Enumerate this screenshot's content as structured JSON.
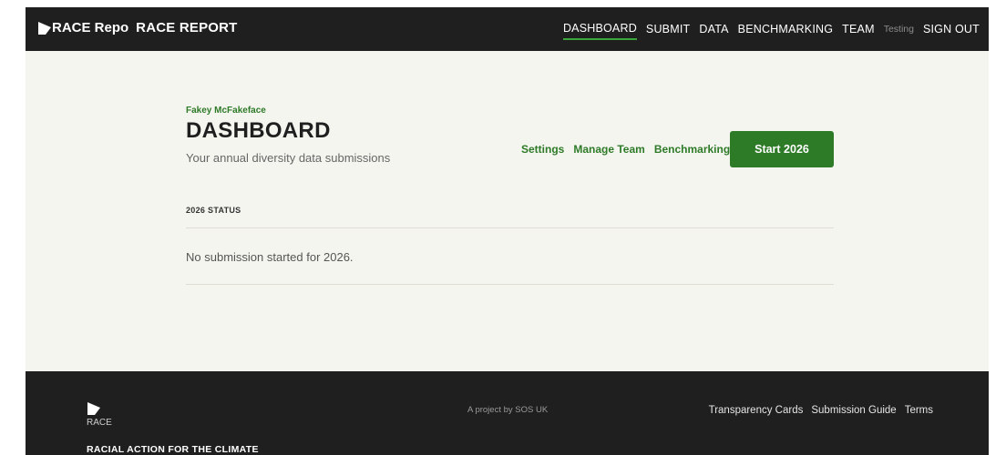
{
  "header": {
    "brand_title": "RACE Repo",
    "brand_report": "RACE REPORT",
    "nav": [
      {
        "label": "DASHBOARD",
        "active": true
      },
      {
        "label": "SUBMIT"
      },
      {
        "label": "DATA"
      },
      {
        "label": "BENCHMARKING"
      },
      {
        "label": "TEAM"
      }
    ],
    "environment_label": "Testing",
    "signout_label": "SIGN OUT"
  },
  "dashboard": {
    "user_name": "Fakey McFakeface",
    "title": "DASHBOARD",
    "subtitle": "Your annual diversity data submissions",
    "quick_links": [
      {
        "label": "Settings"
      },
      {
        "label": "Manage Team"
      },
      {
        "label": "Benchmarking"
      }
    ],
    "start_button_label": "Start 2026",
    "status_heading": "2026 STATUS",
    "status_message": "No submission started for 2026."
  },
  "footer": {
    "logo_text": "RACE",
    "tagline": "RACIAL ACTION FOR THE CLIMATE",
    "project_text": "A project by SOS UK",
    "links": [
      {
        "label": "Transparency Cards"
      },
      {
        "label": "Submission Guide"
      },
      {
        "label": "Terms"
      }
    ]
  },
  "colors": {
    "header_bg": "#1f1f1f",
    "main_bg": "#f5f5f0",
    "accent_green": "#2d7a27",
    "nav_active_underline": "#3aa53a"
  },
  "icons": {
    "brand_logo": "race-logo-icon",
    "footer_logo": "race-logo-icon"
  }
}
